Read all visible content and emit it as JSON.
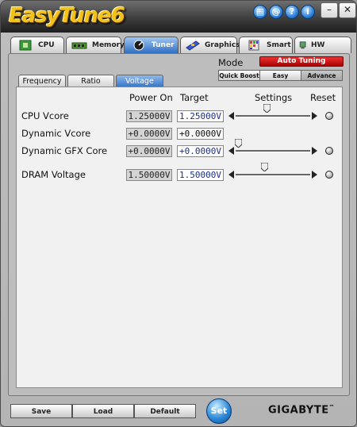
{
  "app": {
    "title": "EasyTune6"
  },
  "titlebar": {
    "icons": [
      "document-icon",
      "at-icon",
      "help-icon",
      "info-icon"
    ],
    "glyphs": [
      "▤",
      "@",
      "?",
      "i"
    ],
    "minimize": "–",
    "close": "✕"
  },
  "main_tabs": [
    {
      "label": "CPU",
      "icon": "cpu-chip-icon",
      "active": false
    },
    {
      "label": "Memory",
      "icon": "memory-stick-icon",
      "active": false
    },
    {
      "label": "Tuner",
      "icon": "tuner-gauge-icon",
      "active": true
    },
    {
      "label": "Graphics",
      "icon": "graphics-card-icon",
      "active": false
    },
    {
      "label": "Smart",
      "icon": "smart-cube-icon",
      "active": false
    },
    {
      "label": "HW Monitor",
      "icon": "hw-monitor-icon",
      "active": false
    }
  ],
  "mode": {
    "label": "Mode",
    "auto_tuning": "Auto Tuning",
    "buttons": [
      {
        "label": "Quick Boost",
        "selected": false
      },
      {
        "label": "Easy",
        "selected": false
      },
      {
        "label": "Advance",
        "selected": true
      }
    ]
  },
  "sub_tabs": [
    {
      "label": "Frequency",
      "active": false
    },
    {
      "label": "Ratio",
      "active": false
    },
    {
      "label": "Voltage",
      "active": true
    }
  ],
  "columns": {
    "power_on": "Power On",
    "target": "Target",
    "settings": "Settings",
    "reset": "Reset"
  },
  "rows": [
    {
      "label": "CPU Vcore",
      "power_on": "1.25000V",
      "target": "1.25000V",
      "slider_level": 0.42,
      "editable": true
    },
    {
      "label": "Dynamic Vcore",
      "power_on": "+0.0000V",
      "target": "+0.0000V",
      "slider_level": null,
      "editable": false
    },
    {
      "label": "Dynamic GFX Core",
      "power_on": "+0.0000V",
      "target": "+0.0000V",
      "slider_level": 0.04,
      "editable": true
    },
    {
      "label": "DRAM Voltage",
      "power_on": "1.50000V",
      "target": "1.50000V",
      "slider_level": 0.39,
      "editable": true
    }
  ],
  "footer": {
    "save": "Save",
    "load": "Load",
    "default": "Default",
    "set": "Set",
    "brand": "GIGABYTE",
    "brand_mark": "™"
  },
  "colors": {
    "logo": "#f3c21a",
    "active_tab": "#2f6fc2",
    "auto_tuning": "#cc1111",
    "target_text": "#1a2f8a",
    "set_button": "#2f8ad8"
  }
}
